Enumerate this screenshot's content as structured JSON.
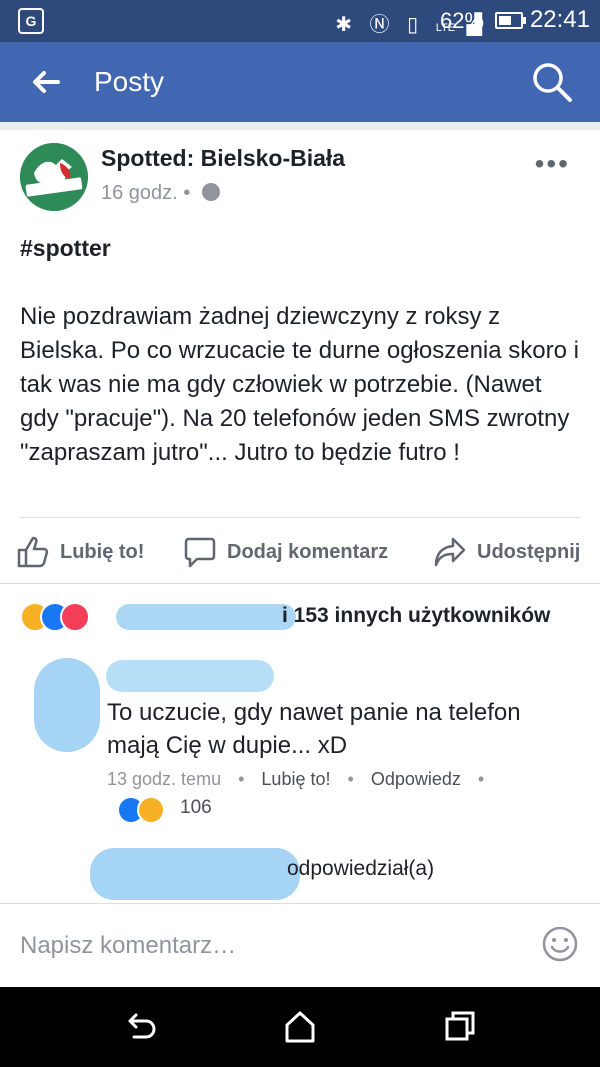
{
  "status_bar": {
    "battery_level": "62%",
    "battery_fraction": 0.62,
    "time": "22:41",
    "lte_label": "LTE"
  },
  "app_bar": {
    "title": "Posty"
  },
  "post": {
    "author": "Spotted: Bielsko-Biała",
    "time": "16 godz.",
    "dot": "•",
    "hashtag": "#spotter",
    "body": "Nie pozdrawiam żadnej dziewczyny z roksy z Bielska. Po co wrzucacie te durne ogłoszenia skoro i tak was nie ma gdy człowiek w potrzebie. (Nawet gdy \"pracuje\"). Na 20 telefonów jeden SMS zwrotny \"zapraszam jutro\"... Jutro to będzie futro !"
  },
  "actions": {
    "like": "Lubię to!",
    "comment": "Dodaj komentarz",
    "share": "Udostępnij"
  },
  "reactions": {
    "summary": "i 153 innych użytkowników"
  },
  "comment": {
    "text": "To uczucie, gdy nawet panie na telefon mają Cię w dupie... xD",
    "time": "13 godz. temu",
    "like": "Lubię to!",
    "reply": "Odpowiedz",
    "sep": "•",
    "reaction_count": "106",
    "reply_summary": "odpowiedział(a)"
  },
  "composer": {
    "placeholder": "Napisz komentarz…"
  },
  "colors": {
    "status_bar": "#2e4a7d",
    "app_bar": "#4267b2",
    "like_blue": "#1877f2",
    "haha_yellow": "#f7b125",
    "love_red": "#f33e58",
    "blur": "#8fc9f2"
  },
  "icons": {
    "back": "arrow-left-icon",
    "search": "search-icon",
    "more": "more-dots-icon",
    "like": "thumbs-up-icon",
    "comment": "speech-bubble-icon",
    "share": "share-arrow-icon",
    "emoji": "smiley-icon",
    "nav_back": "back-nav-icon",
    "nav_home": "home-nav-icon",
    "nav_recent": "recent-apps-icon"
  }
}
